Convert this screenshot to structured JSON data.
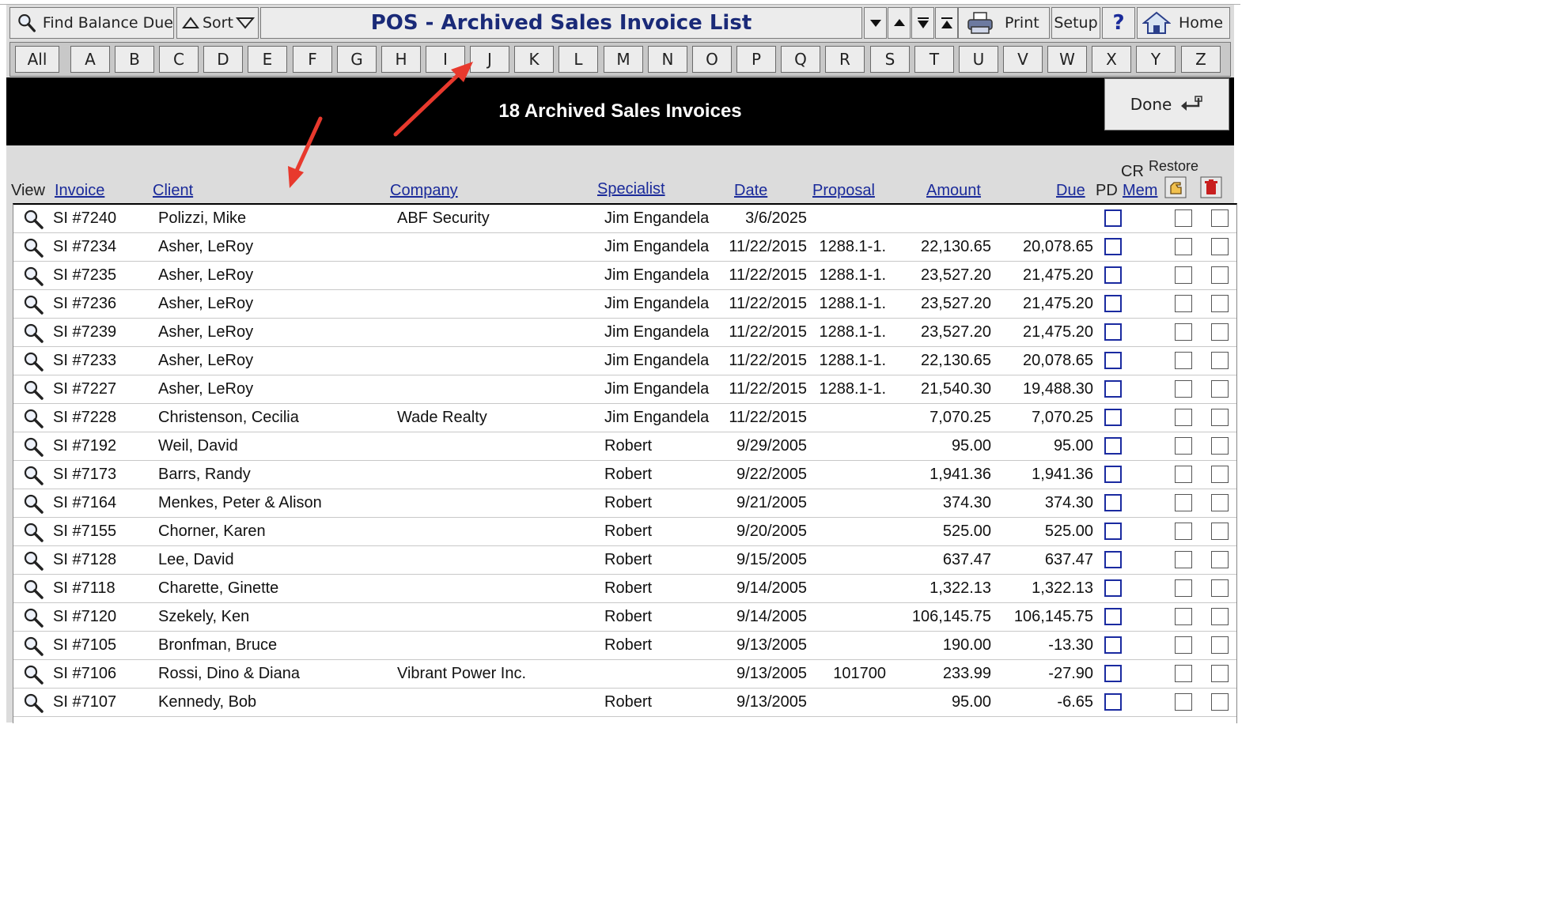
{
  "toolbar": {
    "find_label": "Find Balance Due",
    "sort_label": "Sort",
    "title": "POS - Archived Sales Invoice List",
    "print_label": "Print",
    "setup_label": "Setup",
    "help_label": "?",
    "home_label": "Home"
  },
  "letters": [
    "All",
    "A",
    "B",
    "C",
    "D",
    "E",
    "F",
    "G",
    "H",
    "I",
    "J",
    "K",
    "L",
    "M",
    "N",
    "O",
    "P",
    "Q",
    "R",
    "S",
    "T",
    "U",
    "V",
    "W",
    "X",
    "Y",
    "Z"
  ],
  "banner": {
    "text": "18 Archived Sales Invoices",
    "done_label": "Done"
  },
  "headers": {
    "view": "View",
    "invoice": "Invoice",
    "client": "Client",
    "company": "Company",
    "specialist": "Specialist",
    "date": "Date",
    "proposal": "Proposal",
    "amount": "Amount",
    "due": "Due",
    "pd": "PD",
    "cr": "CR",
    "mem": "Mem",
    "restore": "Restore"
  },
  "rows": [
    {
      "invoice": "SI #7240",
      "client": "Polizzi, Mike",
      "company": "ABF Security",
      "specialist": "Jim Engandela",
      "date": "3/6/2025",
      "proposal": "",
      "amount": "",
      "due": ""
    },
    {
      "invoice": "SI #7234",
      "client": "Asher, LeRoy",
      "company": "",
      "specialist": "Jim Engandela",
      "date": "11/22/2015",
      "proposal": "1288.1-1.",
      "amount": "22,130.65",
      "due": "20,078.65"
    },
    {
      "invoice": "SI #7235",
      "client": "Asher, LeRoy",
      "company": "",
      "specialist": "Jim Engandela",
      "date": "11/22/2015",
      "proposal": "1288.1-1.",
      "amount": "23,527.20",
      "due": "21,475.20"
    },
    {
      "invoice": "SI #7236",
      "client": "Asher, LeRoy",
      "company": "",
      "specialist": "Jim Engandela",
      "date": "11/22/2015",
      "proposal": "1288.1-1.",
      "amount": "23,527.20",
      "due": "21,475.20"
    },
    {
      "invoice": "SI #7239",
      "client": "Asher, LeRoy",
      "company": "",
      "specialist": "Jim Engandela",
      "date": "11/22/2015",
      "proposal": "1288.1-1.",
      "amount": "23,527.20",
      "due": "21,475.20"
    },
    {
      "invoice": "SI #7233",
      "client": "Asher, LeRoy",
      "company": "",
      "specialist": "Jim Engandela",
      "date": "11/22/2015",
      "proposal": "1288.1-1.",
      "amount": "22,130.65",
      "due": "20,078.65"
    },
    {
      "invoice": "SI #7227",
      "client": "Asher, LeRoy",
      "company": "",
      "specialist": "Jim Engandela",
      "date": "11/22/2015",
      "proposal": "1288.1-1.",
      "amount": "21,540.30",
      "due": "19,488.30"
    },
    {
      "invoice": "SI #7228",
      "client": "Christenson, Cecilia",
      "company": "Wade Realty",
      "specialist": "Jim Engandela",
      "date": "11/22/2015",
      "proposal": "",
      "amount": "7,070.25",
      "due": "7,070.25"
    },
    {
      "invoice": "SI #7192",
      "client": "Weil, David",
      "company": "",
      "specialist": "Robert",
      "date": "9/29/2005",
      "proposal": "",
      "amount": "95.00",
      "due": "95.00"
    },
    {
      "invoice": "SI #7173",
      "client": "Barrs, Randy",
      "company": "",
      "specialist": "Robert",
      "date": "9/22/2005",
      "proposal": "",
      "amount": "1,941.36",
      "due": "1,941.36"
    },
    {
      "invoice": "SI #7164",
      "client": "Menkes, Peter & Alison",
      "company": "",
      "specialist": "Robert",
      "date": "9/21/2005",
      "proposal": "",
      "amount": "374.30",
      "due": "374.30"
    },
    {
      "invoice": "SI #7155",
      "client": "Chorner, Karen",
      "company": "",
      "specialist": "Robert",
      "date": "9/20/2005",
      "proposal": "",
      "amount": "525.00",
      "due": "525.00"
    },
    {
      "invoice": "SI #7128",
      "client": "Lee, David",
      "company": "",
      "specialist": "Robert",
      "date": "9/15/2005",
      "proposal": "",
      "amount": "637.47",
      "due": "637.47"
    },
    {
      "invoice": "SI #7118",
      "client": "Charette, Ginette",
      "company": "",
      "specialist": "Robert",
      "date": "9/14/2005",
      "proposal": "",
      "amount": "1,322.13",
      "due": "1,322.13"
    },
    {
      "invoice": "SI #7120",
      "client": "Szekely, Ken",
      "company": "",
      "specialist": "Robert",
      "date": "9/14/2005",
      "proposal": "",
      "amount": "106,145.75",
      "due": "106,145.75"
    },
    {
      "invoice": "SI #7105",
      "client": "Bronfman, Bruce",
      "company": "",
      "specialist": "Robert",
      "date": "9/13/2005",
      "proposal": "",
      "amount": "190.00",
      "due": "-13.30"
    },
    {
      "invoice": "SI #7106",
      "client": "Rossi, Dino & Diana",
      "company": "Vibrant Power Inc.",
      "specialist": "",
      "date": "9/13/2005",
      "proposal": "101700",
      "amount": "233.99",
      "due": "-27.90"
    },
    {
      "invoice": "SI #7107",
      "client": "Kennedy, Bob",
      "company": "",
      "specialist": "Robert",
      "date": "9/13/2005",
      "proposal": "",
      "amount": "95.00",
      "due": "-6.65"
    }
  ],
  "colors": {
    "title": "#1a2a78",
    "header_link": "#1a2a9a",
    "pd_checkbox": "#1a2aa0",
    "annotation_arrow": "#e8392d",
    "banner": "#000000"
  },
  "icons": [
    "magnifier-icon",
    "sort-up-icon",
    "sort-down-icon",
    "print-icon",
    "home-icon",
    "done-return-icon",
    "restore-hand-icon",
    "trash-icon"
  ]
}
